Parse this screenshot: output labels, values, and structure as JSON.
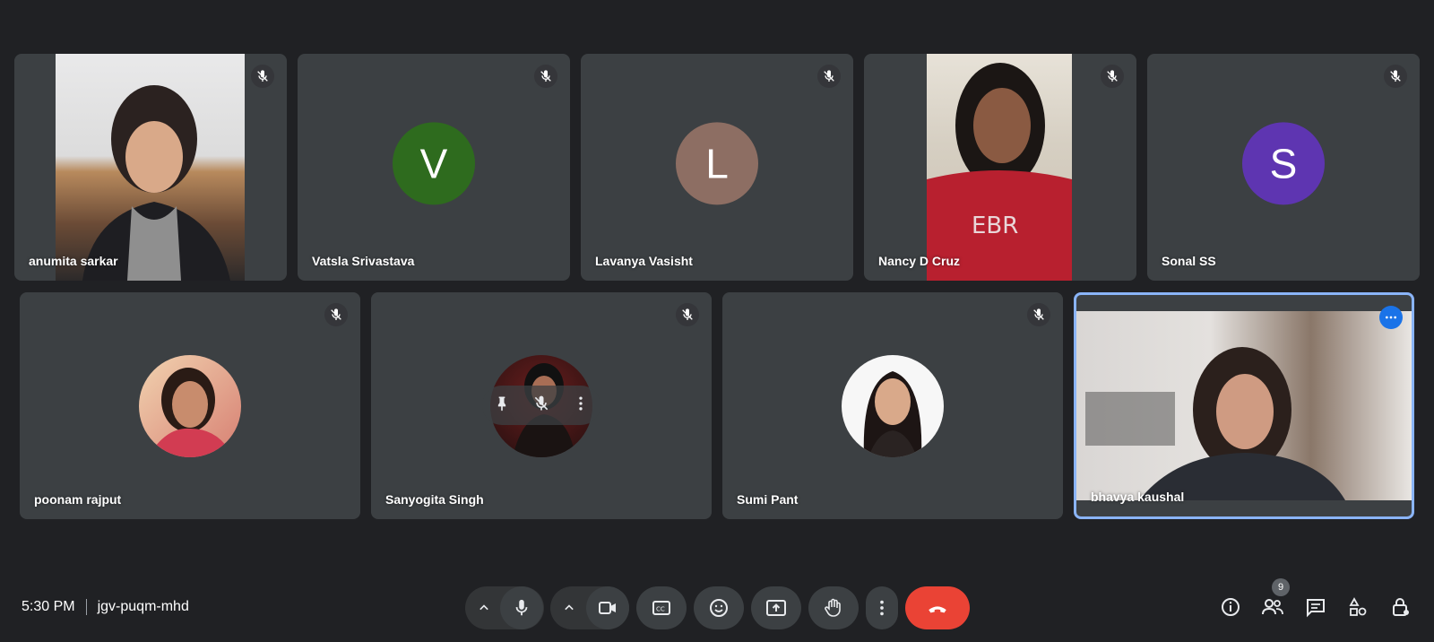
{
  "participants": [
    {
      "name": "anumita sarkar"
    },
    {
      "name": "Vatsla Srivastava",
      "initial": "V",
      "color": "#2e6b1e"
    },
    {
      "name": "Lavanya Vasisht",
      "initial": "L",
      "color": "#8d6e63"
    },
    {
      "name": "Nancy D Cruz"
    },
    {
      "name": "Sonal SS",
      "initial": "S",
      "color": "#5e35b1"
    },
    {
      "name": "poonam rajput"
    },
    {
      "name": "Sanyogita Singh"
    },
    {
      "name": "Sumi Pant"
    },
    {
      "name": "bhavya kaushal"
    }
  ],
  "meeting": {
    "time": "5:30 PM",
    "code": "jgv-puqm-mhd"
  },
  "people_count": "9",
  "colors": {
    "background": "#202124",
    "tile": "#3c4043",
    "end_call": "#ea4335",
    "active_border": "#8ab4f8",
    "accent": "#1a73e8"
  }
}
